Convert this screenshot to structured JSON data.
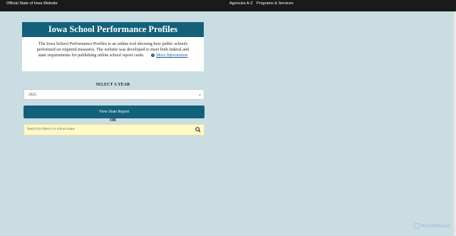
{
  "topbar": {
    "site_label": "Official State of Iowa Website",
    "nav": [
      "Agencies A-Z",
      "Programs & Services"
    ]
  },
  "card": {
    "title": "Iowa School Performance Profiles",
    "description": "The Iowa School Performance Profiles is an online tool showing how public schools performed on required measures. The website was developed to meet both federal and state requirements for publishing online school report cards.",
    "more_info": "More Information"
  },
  "year": {
    "label": "SELECT A YEAR",
    "selected": "2025"
  },
  "state_button": "View State Report",
  "or_label": "OR",
  "search": {
    "placeholder": "Search by district or school name"
  },
  "watermark": "ScanMalware",
  "colors": {
    "background": "#c9dde3",
    "header_bar": "#1a1a1a",
    "brand_teal": "#12607a",
    "search_bg": "#fff9c6"
  }
}
